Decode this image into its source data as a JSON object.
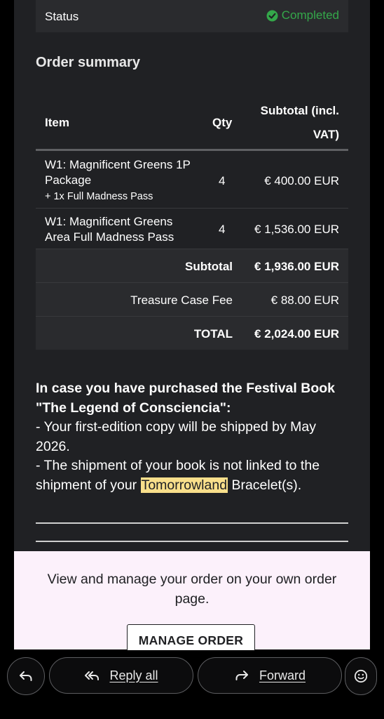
{
  "status": {
    "label": "Status",
    "value": "Completed",
    "color": "#34a84a"
  },
  "order_summary": {
    "title": "Order summary",
    "headers": {
      "item": "Item",
      "qty": "Qty",
      "subtotal_line1": "Subtotal (incl.",
      "subtotal_line2": "VAT)"
    },
    "items": [
      {
        "name_line1": "W1: Magnificent Greens 1P",
        "name_line2": "Package",
        "sub": "+ 1x Full Madness Pass",
        "qty": "4",
        "price": "€ 400.00 EUR"
      },
      {
        "name_line1": "W1: Magnificent Greens",
        "name_line2": "Area Full Madness Pass",
        "qty": "4",
        "price": "€ 1,536.00 EUR"
      }
    ],
    "subtotal": {
      "label": "Subtotal",
      "value": "€ 1,936.00 EUR"
    },
    "fee": {
      "label": "Treasure Case Fee",
      "value": "€ 88.00 EUR"
    },
    "total": {
      "label": "TOTAL",
      "value": "€ 2,024.00 EUR"
    }
  },
  "book_note": {
    "heading": "In case you have purchased the Festival Book \"The Legend of Consciencia\":",
    "line1": "- Your first-edition copy will be shipped by May 2026.",
    "line2_before": "- The shipment of your book is not linked to the shipment of your ",
    "line2_highlight": "Tomorrowland",
    "line2_after": " Bracelet(s)."
  },
  "manage": {
    "text": "View and manage your order on your own order page.",
    "button": "MANAGE ORDER"
  },
  "bottom_bar": {
    "reply_all": "Reply all",
    "forward": "Forward",
    "icons": [
      "reply-icon",
      "reply-all-icon",
      "forward-icon",
      "emoji-icon"
    ]
  }
}
